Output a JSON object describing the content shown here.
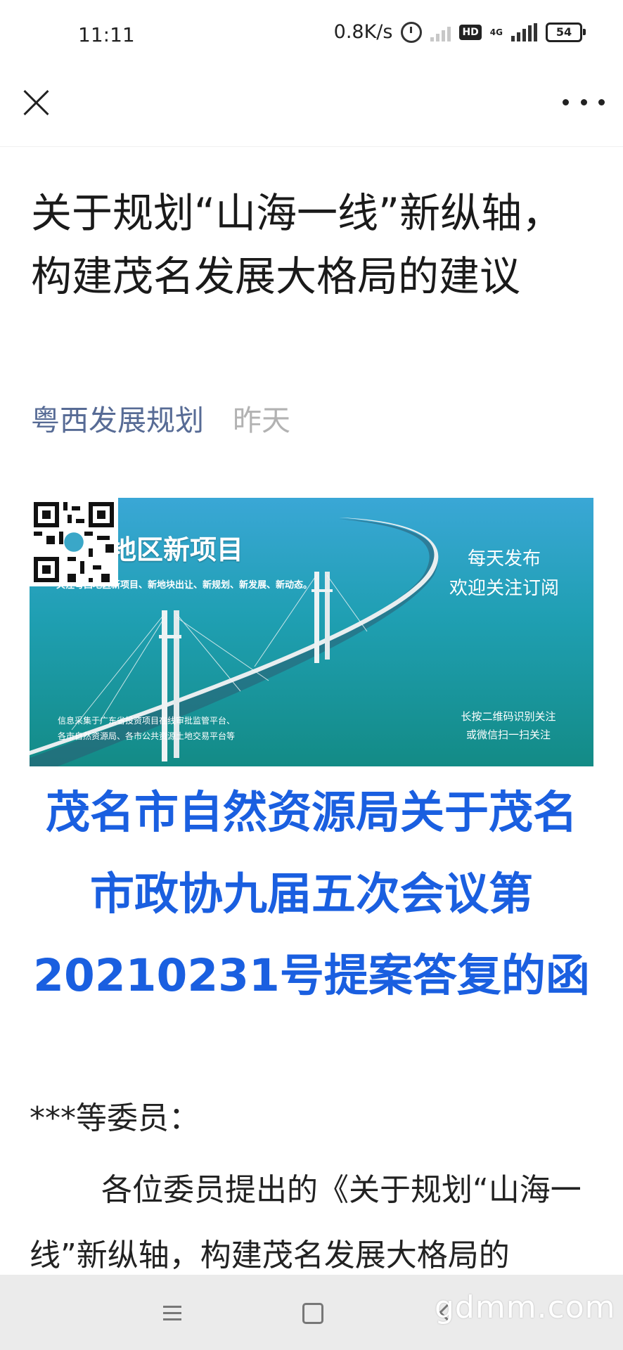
{
  "status_bar": {
    "time": "11:11",
    "net_speed": "0.8K/s",
    "hd_label": "HD",
    "net_type": "4G",
    "battery": "54"
  },
  "nav": {
    "close_icon": "close-icon",
    "more_icon": "more-dots-icon"
  },
  "article": {
    "title": "关于规划“山海一线”新纵轴，构建茂名发展大格局的建议",
    "author": "粤西发展规划",
    "time": "昨天"
  },
  "banner": {
    "title": "粤西地区新项目",
    "subtitle": "关注粤西地区新项目、新地块出让、新规划、新发展、新动态。",
    "daily_line1": "每天发布",
    "daily_line2": "欢迎关注订阅",
    "qr_line1": "长按二维码识别关注",
    "qr_line2": "或微信扫一扫关注",
    "source_line1": "信息采集于广东省投资项目在线审批监管平台、",
    "source_line2": "各市自然资源局、各市公共资源土地交易平台等",
    "colors": {
      "sea": "#1a9ba0",
      "sky": "#3aa7d6"
    }
  },
  "document": {
    "heading": "茂名市自然资源局关于茂名市政协九届五次会议第20210231号提案答复的函",
    "salutation": "***等委员：",
    "body": "各位委员提出的《关于规划“山海一线”新纵轴，构建茂名发展大格局的"
  },
  "bottom_nav": {
    "watermark": "gdmm.com"
  }
}
